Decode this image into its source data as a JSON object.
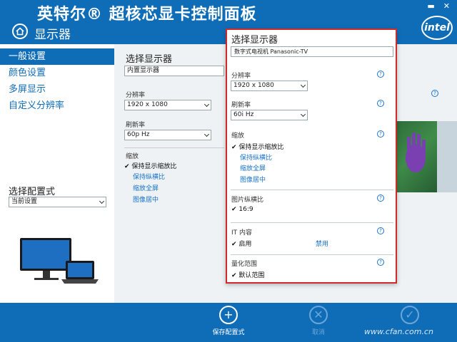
{
  "header": {
    "app_title": "英特尔® 超核芯显卡控制面板",
    "section": "显示器",
    "logo_text": "intel"
  },
  "sidebar": {
    "items": [
      {
        "label": "一般设置",
        "active": true
      },
      {
        "label": "颜色设置",
        "active": false
      },
      {
        "label": "多屏显示",
        "active": false
      },
      {
        "label": "自定义分辨率",
        "active": false
      }
    ],
    "profile_label": "选择配置式",
    "profile_value": "当前设置"
  },
  "main": {
    "select_display_label": "选择显示器",
    "display_value": "内置显示器",
    "resolution_label": "分辨率",
    "resolution_value": "1920 x 1080",
    "refresh_label": "刷新率",
    "refresh_value": "60p Hz",
    "scaling_label": "缩放",
    "scaling_options": [
      "保持显示缩放比",
      "保持纵横比",
      "缩放全屏",
      "图像居中"
    ]
  },
  "popup": {
    "title": "选择显示器",
    "device": "数字式电视机 Panasonic-TV",
    "resolution_label": "分辨率",
    "resolution_value": "1920 x 1080",
    "refresh_label": "刷新率",
    "refresh_value": "60i Hz",
    "scaling_label": "缩放",
    "scaling_options": [
      "保持显示缩放比",
      "保持纵横比",
      "缩放全屏",
      "图像居中"
    ],
    "aspect_label": "图片纵横比",
    "aspect_value": "16:9",
    "it_label": "IT 内容",
    "it_enable": "启用",
    "it_disable": "禁用",
    "quant_label": "量化范围",
    "quant_value": "默认范围"
  },
  "footer": {
    "save_label": "保存配置式",
    "cancel_label": "取消",
    "apply_label": "应用",
    "watermark": "www.cfan.com.cn"
  }
}
